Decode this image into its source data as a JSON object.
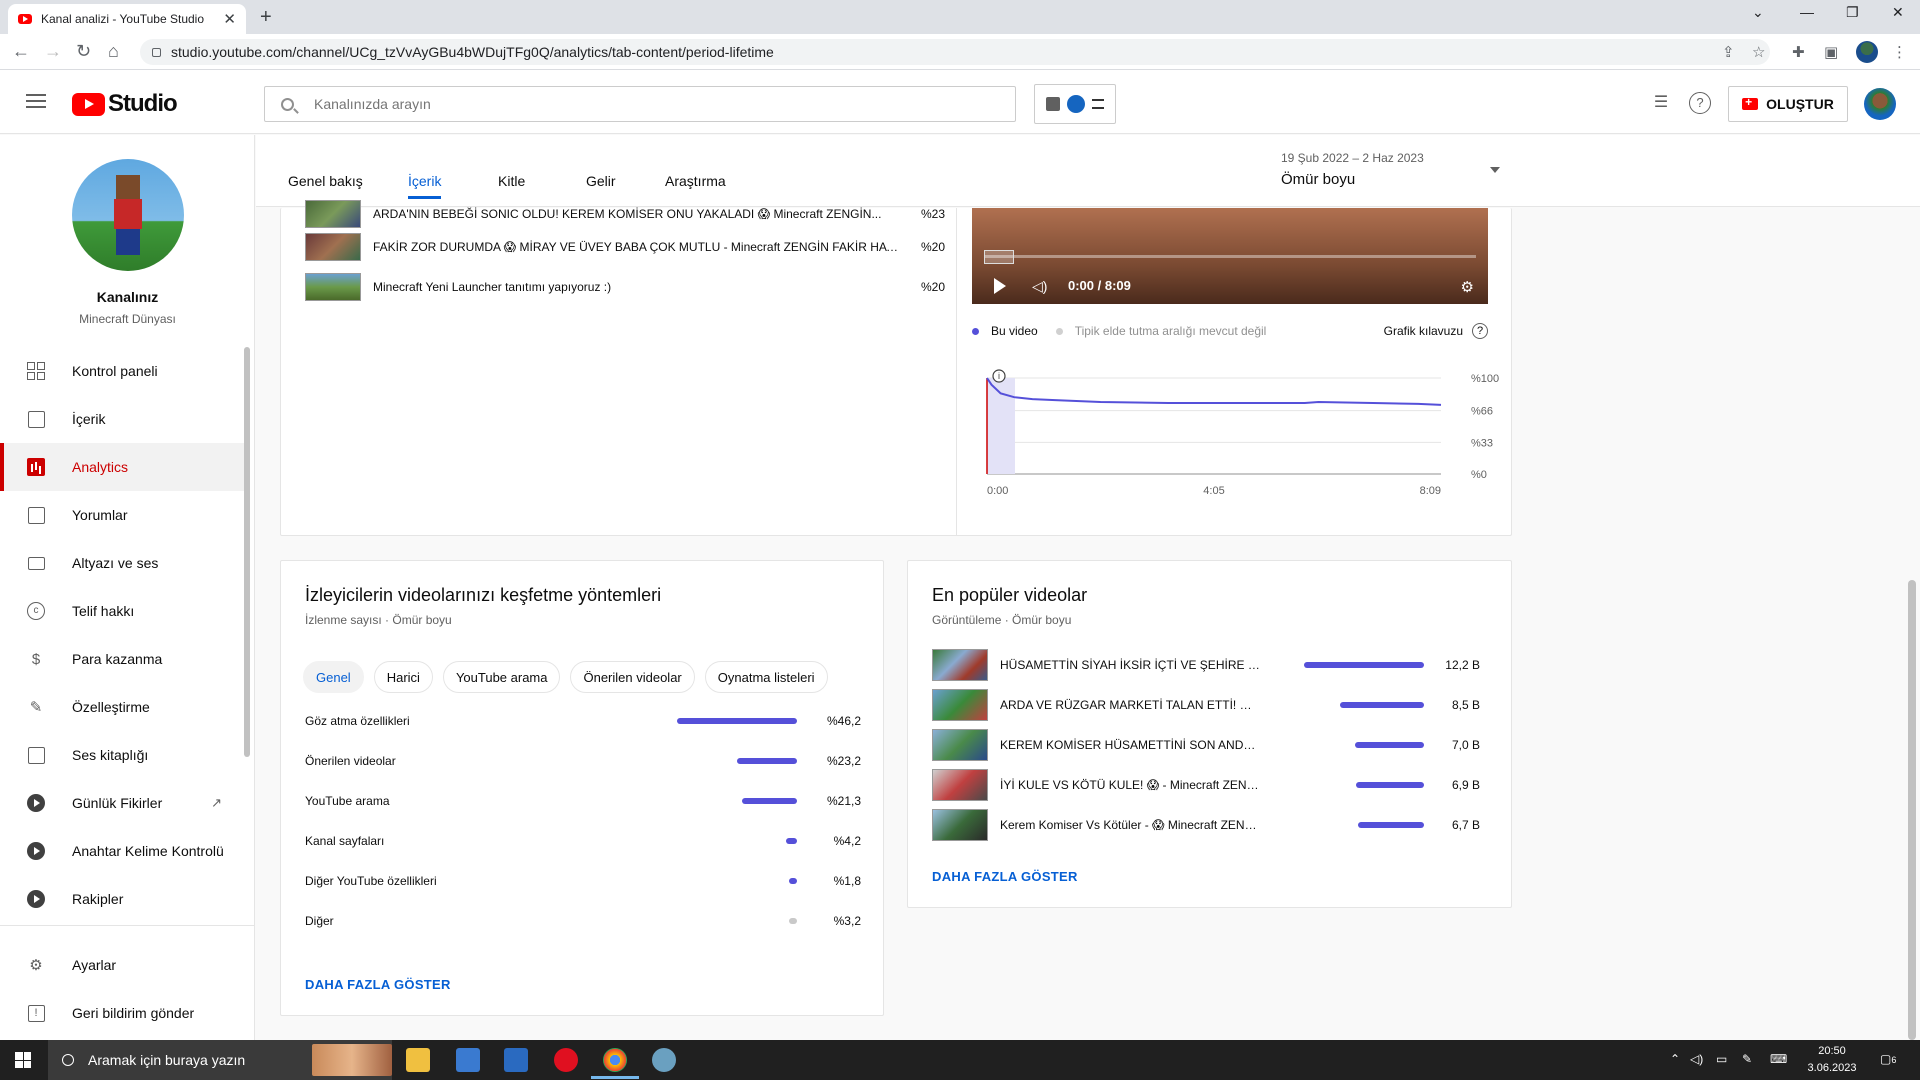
{
  "browser": {
    "tab_title": "Kanal analizi - YouTube Studio",
    "tab_close": "✕",
    "new_tab": "+",
    "url": "studio.youtube.com/channel/UCg_tzVvAyGBu4bWDujTFg0Q/analytics/tab-content/period-lifetime",
    "window_controls": [
      "⌄",
      "—",
      "❐",
      "✕"
    ]
  },
  "header": {
    "logo_text": "Studio",
    "search_placeholder": "Kanalınızda arayın",
    "create_label": "OLUŞTUR",
    "help_glyph": "?"
  },
  "channel": {
    "name": "Kanalınız",
    "subtitle": "Minecraft Dünyası"
  },
  "sidebar": {
    "items": [
      {
        "label": "Kontrol paneli",
        "icon": "dashboard-icon"
      },
      {
        "label": "İçerik",
        "icon": "content-icon"
      },
      {
        "label": "Analytics",
        "icon": "analytics-icon",
        "active": true
      },
      {
        "label": "Yorumlar",
        "icon": "comments-icon"
      },
      {
        "label": "Altyazı ve ses",
        "icon": "subtitles-icon"
      },
      {
        "label": "Telif hakkı",
        "icon": "copyright-icon"
      },
      {
        "label": "Para kazanma",
        "icon": "monetization-icon"
      },
      {
        "label": "Özelleştirme",
        "icon": "customization-icon"
      },
      {
        "label": "Ses kitaplığı",
        "icon": "audio-library-icon"
      },
      {
        "label": "Günlük Fikirler",
        "icon": "extension-play-icon",
        "external": true
      },
      {
        "label": "Anahtar Kelime Kontrolü",
        "icon": "extension-play-icon"
      },
      {
        "label": "Rakipler",
        "icon": "extension-play-icon"
      }
    ],
    "bottom_items": [
      {
        "label": "Ayarlar",
        "icon": "settings-icon"
      },
      {
        "label": "Geri bildirim gönder",
        "icon": "feedback-icon"
      }
    ]
  },
  "analytics_tabs": {
    "tabs": [
      "Genel bakış",
      "İçerik",
      "Kitle",
      "Gelir",
      "Araştırma"
    ],
    "active": "İçerik",
    "period_range": "19 Şub 2022 – 2 Haz 2023",
    "period_label": "Ömür boyu"
  },
  "retention_list": [
    {
      "title": "ARDA'NIN BEBEĞİ SONIC OLDU! KEREM KOMİSER ONU YAKALADI 😱 Minecraft ZENGİN...",
      "value": "%23"
    },
    {
      "title": "FAKİR ZOR DURUMDA 😱 MİRAY VE ÜVEY BABA ÇOK MUTLU - Minecraft ZENGİN FAKİR HAYATI",
      "value": "%20"
    },
    {
      "title": "Minecraft Yeni Launcher tanıtımı yapıyoruz :)",
      "value": "%20"
    }
  ],
  "player": {
    "time": "0:00 / 8:09"
  },
  "retention_chart": {
    "legend_this": "Bu video",
    "legend_typical": "Tipik elde tutma aralığı mevcut değil",
    "guide_label": "Grafik kılavuzu",
    "guide_glyph": "?",
    "info_glyph": "i",
    "colors": {
      "line": "#5550d9",
      "marker": "#cc0000",
      "band": "#e3e2f7"
    }
  },
  "chart_data": {
    "type": "line",
    "title": "",
    "xlabel": "",
    "ylabel": "",
    "x_ticks": [
      "0:00",
      "4:05",
      "8:09"
    ],
    "y_ticks": [
      "%100",
      "%66",
      "%33",
      "%0"
    ],
    "ylim": [
      0,
      100
    ],
    "series": [
      {
        "x": [
          0,
          0.01,
          0.03,
          0.06,
          0.1,
          0.15,
          0.25,
          0.4,
          0.55,
          0.7,
          0.73,
          0.85,
          0.95,
          1.0
        ],
        "values": [
          100,
          93,
          84,
          80,
          78,
          77,
          75,
          74,
          74,
          74,
          75,
          74,
          73,
          72
        ]
      }
    ],
    "grid": true
  },
  "discovery": {
    "title": "İzleyicilerin videolarınızı keşfetme yöntemleri",
    "subtitle": "İzlenme sayısı · Ömür boyu",
    "chips": [
      "Genel",
      "Harici",
      "YouTube arama",
      "Önerilen videolar",
      "Oynatma listeleri"
    ],
    "active_chip": "Genel",
    "rows": [
      {
        "label": "Göz atma özellikleri",
        "value": "%46,2",
        "pct": 46.2
      },
      {
        "label": "Önerilen videolar",
        "value": "%23,2",
        "pct": 23.2
      },
      {
        "label": "YouTube arama",
        "value": "%21,3",
        "pct": 21.3
      },
      {
        "label": "Kanal sayfaları",
        "value": "%4,2",
        "pct": 4.2
      },
      {
        "label": "Diğer YouTube özellikleri",
        "value": "%1,8",
        "pct": 1.8
      },
      {
        "label": "Diğer",
        "value": "%3,2",
        "pct": 3.2,
        "grey": true
      }
    ],
    "show_more": "DAHA FAZLA GÖSTER"
  },
  "popular": {
    "title": "En popüler videolar",
    "subtitle": "Görüntüleme · Ömür boyu",
    "rows": [
      {
        "title": "HÜSAMETTİN SİYAH İKSİR İÇTİ VE ŞEHİRE SALDIRDI",
        "value": "12,2 B",
        "views": 12.2
      },
      {
        "title": "ARDA VE RÜZGAR MARKETİ TALAN ETTİ! 😱 Minecraft",
        "value": "8,5 B",
        "views": 8.5
      },
      {
        "title": "KEREM KOMİSER HÜSAMETTİNİ SON ANDA KURTARDI",
        "value": "7,0 B",
        "views": 7.0
      },
      {
        "title": "İYİ KULE VS KÖTÜ KULE! 😱 - Minecraft ZENGİN FAKİR",
        "value": "6,9 B",
        "views": 6.9
      },
      {
        "title": "Kerem Komiser Vs Kötüler - 😱 Minecraft ZENGİN FAKİR",
        "value": "6,7 B",
        "views": 6.7
      }
    ],
    "show_more": "DAHA FAZLA GÖSTER"
  },
  "taskbar": {
    "search_placeholder": "Aramak için buraya yazın",
    "time": "20:50",
    "date": "3.06.2023",
    "notifications": "6"
  }
}
